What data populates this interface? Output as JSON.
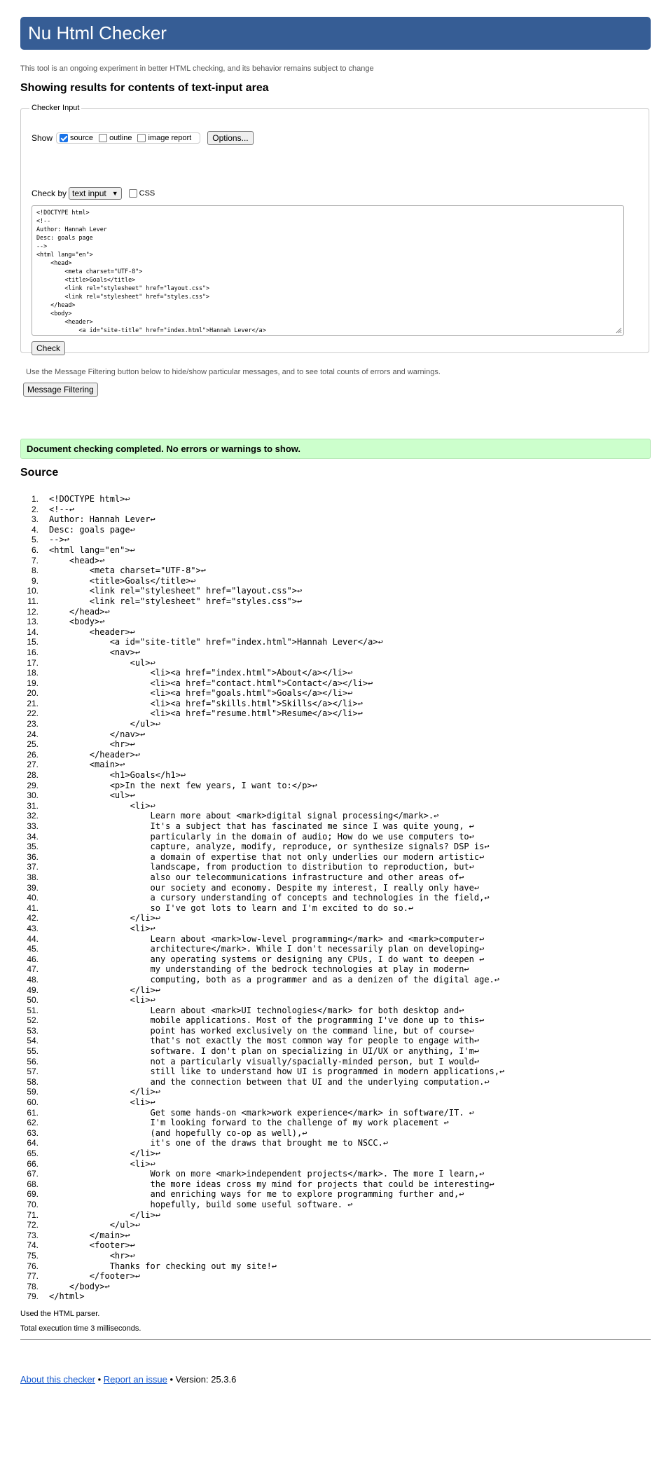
{
  "header": {
    "title": "Nu Html Checker"
  },
  "tagline": "This tool is an ongoing experiment in better HTML checking, and its behavior remains subject to change",
  "results_title": "Showing results for contents of text-input area",
  "checker_input": {
    "legend": "Checker Input",
    "show_label": "Show",
    "options": [
      {
        "label": "source",
        "checked": true
      },
      {
        "label": "outline",
        "checked": false
      },
      {
        "label": "image report",
        "checked": false
      }
    ],
    "options_button": "Options...",
    "check_by_label": "Check by",
    "check_by_value": "text input",
    "css_label": "CSS",
    "css_checked": false,
    "textarea_value": "<!DOCTYPE html>\n<!--\nAuthor: Hannah Lever\nDesc: goals page\n-->\n<html lang=\"en\">\n    <head>\n        <meta charset=\"UTF-8\">\n        <title>Goals</title>\n        <link rel=\"stylesheet\" href=\"layout.css\">\n        <link rel=\"stylesheet\" href=\"styles.css\">\n    </head>\n    <body>\n        <header>\n            <a id=\"site-title\" href=\"index.html\">Hannah Lever</a>",
    "check_button": "Check"
  },
  "message_filter_note": "Use the Message Filtering button below to hide/show particular messages, and to see total counts of errors and warnings.",
  "message_filter_button": "Message Filtering",
  "success_message": "Document checking completed. No errors or warnings to show.",
  "source_title": "Source",
  "source_lines": [
    "<!DOCTYPE html>↩",
    "<!--↩",
    "Author: Hannah Lever↩",
    "Desc: goals page↩",
    "-->↩",
    "<html lang=\"en\">↩",
    "    <head>↩",
    "        <meta charset=\"UTF-8\">↩",
    "        <title>Goals</title>↩",
    "        <link rel=\"stylesheet\" href=\"layout.css\">↩",
    "        <link rel=\"stylesheet\" href=\"styles.css\">↩",
    "    </head>↩",
    "    <body>↩",
    "        <header>↩",
    "            <a id=\"site-title\" href=\"index.html\">Hannah Lever</a>↩",
    "            <nav>↩",
    "                <ul>↩",
    "                    <li><a href=\"index.html\">About</a></li>↩",
    "                    <li><a href=\"contact.html\">Contact</a></li>↩",
    "                    <li><a href=\"goals.html\">Goals</a></li>↩",
    "                    <li><a href=\"skills.html\">Skills</a></li>↩",
    "                    <li><a href=\"resume.html\">Resume</a></li>↩",
    "                </ul>↩",
    "            </nav>↩",
    "            <hr>↩",
    "        </header>↩",
    "        <main>↩",
    "            <h1>Goals</h1>↩",
    "            <p>In the next few years, I want to:</p>↩",
    "            <ul>↩",
    "                <li>↩",
    "                    Learn more about <mark>digital signal processing</mark>.↩",
    "                    It's a subject that has fascinated me since I was quite young, ↩",
    "                    particularly in the domain of audio; How do we use computers to↩",
    "                    capture, analyze, modify, reproduce, or synthesize signals? DSP is↩",
    "                    a domain of expertise that not only underlies our modern artistic↩",
    "                    landscape, from production to distribution to reproduction, but↩",
    "                    also our telecommunications infrastructure and other areas of↩",
    "                    our society and economy. Despite my interest, I really only have↩",
    "                    a cursory understanding of concepts and technologies in the field,↩",
    "                    so I've got lots to learn and I'm excited to do so.↩",
    "                </li>↩",
    "                <li>↩",
    "                    Learn about <mark>low-level programming</mark> and <mark>computer↩",
    "                    architecture</mark>. While I don't necessarily plan on developing↩",
    "                    any operating systems or designing any CPUs, I do want to deepen ↩",
    "                    my understanding of the bedrock technologies at play in modern↩",
    "                    computing, both as a programmer and as a denizen of the digital age.↩",
    "                </li>↩",
    "                <li>↩",
    "                    Learn about <mark>UI technologies</mark> for both desktop and↩",
    "                    mobile applications. Most of the programming I've done up to this↩",
    "                    point has worked exclusively on the command line, but of course↩",
    "                    that's not exactly the most common way for people to engage with↩",
    "                    software. I don't plan on specializing in UI/UX or anything, I'm↩",
    "                    not a particularly visually/spacially-minded person, but I would↩",
    "                    still like to understand how UI is programmed in modern applications,↩",
    "                    and the connection between that UI and the underlying computation.↩",
    "                </li>↩",
    "                <li>↩",
    "                    Get some hands-on <mark>work experience</mark> in software/IT. ↩",
    "                    I'm looking forward to the challenge of my work placement ↩",
    "                    (and hopefully co-op as well),↩",
    "                    it's one of the draws that brought me to NSCC.↩",
    "                </li>↩",
    "                <li>↩",
    "                    Work on more <mark>independent projects</mark>. The more I learn,↩",
    "                    the more ideas cross my mind for projects that could be interesting↩",
    "                    and enriching ways for me to explore programming further and,↩",
    "                    hopefully, build some useful software. ↩",
    "                </li>↩",
    "            </ul>↩",
    "        </main>↩",
    "        <footer>↩",
    "            <hr>↩",
    "            Thanks for checking out my site!↩",
    "        </footer>↩",
    "    </body>↩",
    "</html>"
  ],
  "parser_note": "Used the HTML parser.",
  "exec_time": "Total execution time 3 milliseconds.",
  "footer": {
    "about_link": "About this checker",
    "sep1": "•",
    "report_link": "Report an issue",
    "sep2": "•",
    "version": "Version: 25.3.6"
  }
}
